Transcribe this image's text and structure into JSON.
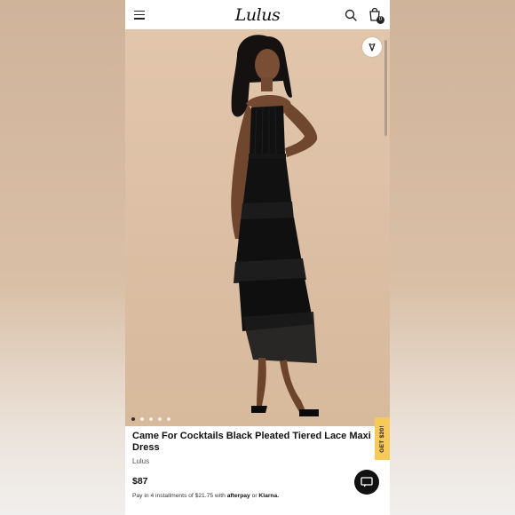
{
  "header": {
    "logo_text": "Lulus",
    "bag_count": "0"
  },
  "gallery": {
    "dot_count": 5,
    "active_index": 0
  },
  "product": {
    "title": "Came For Cocktails Black Pleated Tiered Lace Maxi Dress",
    "brand": "Lulus",
    "price": "$87",
    "installments_prefix": "Pay in 4 installments of $21.75 with",
    "afterpay_label": "afterpay",
    "or_label": "or",
    "klarna_label": "Klarna."
  },
  "promo": {
    "label": "GET $20!"
  },
  "colors": {
    "accent_promo": "#f5c95a",
    "dress": "#111111",
    "background": "#dcbfa4"
  },
  "icons": [
    "menu-icon",
    "search-icon",
    "bag-icon",
    "heart-icon",
    "chat-icon"
  ]
}
